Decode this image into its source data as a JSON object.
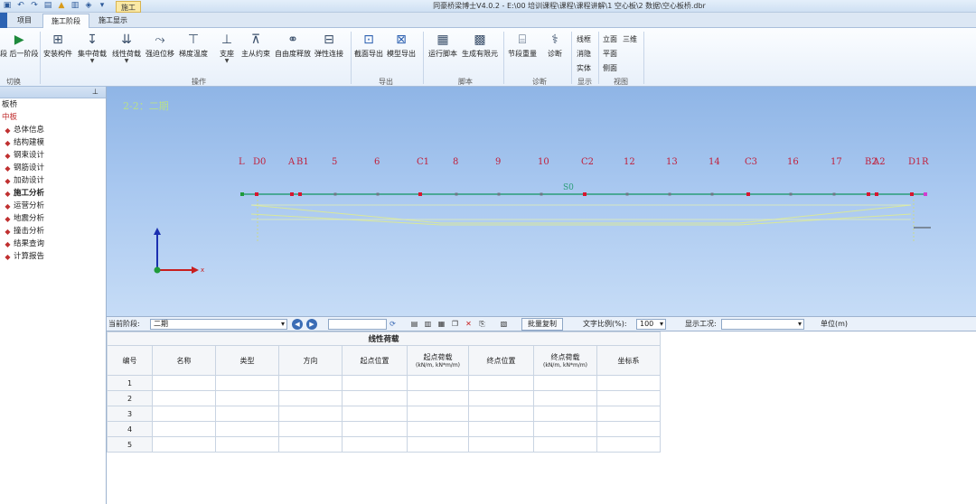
{
  "window": {
    "title": "同豪桥梁博士V4.0.2 - E:\\00 培训课程\\课程\\课程讲解\\1 空心板\\2 数据\\空心板桥.dbr",
    "context_tab": "施工"
  },
  "tabs": [
    {
      "label": "项目"
    },
    {
      "label": "施工阶段"
    },
    {
      "label": "施工显示"
    }
  ],
  "ribbon": {
    "buttons": [
      {
        "label": "后一阶段",
        "icon": "play-forward-icon",
        "prefix": "段"
      },
      {
        "label": "安装构件",
        "icon": "install-component-icon"
      },
      {
        "label": "集中荷载",
        "icon": "point-load-icon"
      },
      {
        "label": "线性荷载",
        "icon": "line-load-icon"
      },
      {
        "label": "强迫位移",
        "icon": "forced-displacement-icon"
      },
      {
        "label": "梯度温度",
        "icon": "gradient-temperature-icon"
      },
      {
        "label": "支座",
        "icon": "support-icon"
      },
      {
        "label": "主从约束",
        "icon": "master-slave-icon"
      },
      {
        "label": "自由度释放",
        "icon": "dof-release-icon"
      },
      {
        "label": "弹性连接",
        "icon": "elastic-link-icon"
      },
      {
        "label": "截面导出",
        "icon": "section-export-icon"
      },
      {
        "label": "模型导出",
        "icon": "model-export-icon"
      },
      {
        "label": "运行脚本",
        "icon": "run-script-icon"
      },
      {
        "label": "生成有限元",
        "icon": "generate-fem-icon"
      },
      {
        "label": "节段重量",
        "icon": "segment-weight-icon"
      },
      {
        "label": "诊断",
        "icon": "stethoscope-icon"
      }
    ],
    "groups": {
      "switch": "切换",
      "operation": "操作",
      "export": "导出",
      "script": "脚本",
      "diagnose": "诊断",
      "display": "显示",
      "view": "视图"
    },
    "display_options": [
      "线框",
      "消隐",
      "实体"
    ],
    "view_options": [
      "立面",
      "三维",
      "平面",
      "侧面"
    ]
  },
  "left_panel": {
    "items": [
      {
        "label": "板桥",
        "icon": "",
        "color": "#222222"
      },
      {
        "label": "中板",
        "icon": "",
        "color": "#c03030"
      },
      {
        "label": "总体信息",
        "icon": "doc-icon",
        "color": "#222222"
      },
      {
        "label": "结构建模",
        "icon": "structure-icon",
        "color": "#222222"
      },
      {
        "label": "钢束设计",
        "icon": "tendon-icon",
        "color": "#222222"
      },
      {
        "label": "钢筋设计",
        "icon": "rebar-icon",
        "color": "#222222"
      },
      {
        "label": "加劲设计",
        "icon": "stiffener-icon",
        "color": "#222222"
      },
      {
        "label": "施工分析",
        "icon": "construction-icon",
        "color": "#222222",
        "bold": true
      },
      {
        "label": "运营分析",
        "icon": "operation-icon",
        "color": "#222222"
      },
      {
        "label": "地震分析",
        "icon": "seismic-icon",
        "color": "#222222"
      },
      {
        "label": "撞击分析",
        "icon": "impact-icon",
        "color": "#222222"
      },
      {
        "label": "结果查询",
        "icon": "result-icon",
        "color": "#222222"
      },
      {
        "label": "计算报告",
        "icon": "report-icon",
        "color": "#222222"
      }
    ]
  },
  "viewport": {
    "stage_label": "2-2：二期",
    "span_label": "S0",
    "nodes": [
      "L",
      "D0",
      "A",
      "B1",
      "5",
      "6",
      "C1",
      "8",
      "9",
      "10",
      "C2",
      "12",
      "13",
      "14",
      "C3",
      "16",
      "17",
      "B2",
      "A2",
      "D1",
      "R"
    ],
    "axis_x_label": "x"
  },
  "toolbar": {
    "stage_label": "当前阶段:",
    "stage_value": "二期",
    "batch_copy": "批量复制",
    "text_scale_label": "文字比例(%):",
    "text_scale_value": "100",
    "display_case_label": "显示工况:",
    "display_case_value": "",
    "unit_label": "单位(m)"
  },
  "table": {
    "title": "线性荷载",
    "columns": [
      "编号",
      "名称",
      "类型",
      "方向",
      "起点位置",
      "起点荷载",
      "终点位置",
      "终点荷载",
      "坐标系"
    ],
    "unit_hint": "(kN/m, kN*m/m)",
    "rows": [
      "1",
      "2",
      "3",
      "4",
      "5"
    ]
  }
}
